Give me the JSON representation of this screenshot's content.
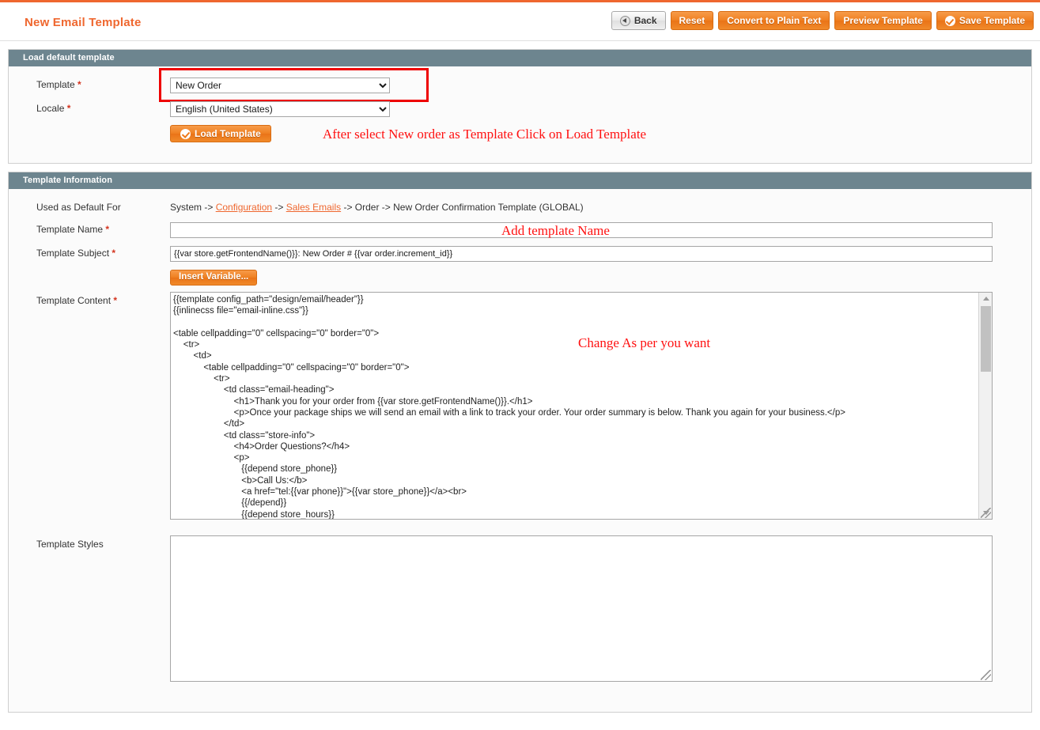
{
  "header": {
    "title": "New Email Template",
    "buttons": [
      {
        "name": "back",
        "label": "Back",
        "style": "gray",
        "icon": "back-arrow-icon"
      },
      {
        "name": "reset",
        "label": "Reset",
        "style": "orange",
        "icon": ""
      },
      {
        "name": "convert-to-plain-text",
        "label": "Convert to Plain Text",
        "style": "orange",
        "icon": ""
      },
      {
        "name": "preview-template",
        "label": "Preview Template",
        "style": "orange",
        "icon": ""
      },
      {
        "name": "save-template",
        "label": "Save Template",
        "style": "orange",
        "icon": "check-circle-icon"
      }
    ]
  },
  "load_default_template": {
    "legend": "Load default template",
    "template_label": "Template",
    "template_value": "New Order",
    "locale_label": "Locale",
    "locale_value": "English (United States)",
    "load_button_label": "Load Template",
    "annotation": "After select New order as Template Click on Load Template"
  },
  "template_information": {
    "legend": "Template Information",
    "used_as_default_label": "Used as Default For",
    "used_as_default": {
      "prefix": "System -> ",
      "link1": "Configuration",
      "mid1": " -> ",
      "link2": "Sales Emails",
      "suffix": " -> Order -> New Order Confirmation Template  (GLOBAL)"
    },
    "template_name_label": "Template Name",
    "template_name_value": "",
    "template_name_annotation": "Add template Name",
    "template_subject_label": "Template Subject",
    "template_subject_value": "{{var store.getFrontendName()}}: New Order # {{var order.increment_id}}",
    "insert_variable_label": "Insert Variable...",
    "template_content_label": "Template Content",
    "template_content_annotation": "Change As per you want",
    "template_content_value": "{{template config_path=\"design/email/header\"}}\n{{inlinecss file=\"email-inline.css\"}}\n\n<table cellpadding=\"0\" cellspacing=\"0\" border=\"0\">\n    <tr>\n        <td>\n            <table cellpadding=\"0\" cellspacing=\"0\" border=\"0\">\n                <tr>\n                    <td class=\"email-heading\">\n                        <h1>Thank you for your order from {{var store.getFrontendName()}}.</h1>\n                        <p>Once your package ships we will send an email with a link to track your order. Your order summary is below. Thank you again for your business.</p>\n                    </td>\n                    <td class=\"store-info\">\n                        <h4>Order Questions?</h4>\n                        <p>\n                           {{depend store_phone}}\n                           <b>Call Us:</b>\n                           <a href=\"tel:{{var phone}}\">{{var store_phone}}</a><br>\n                           {{/depend}}\n                           {{depend store_hours}}\n                           <span class=\"no-link\">{{var store_hours}}</span><br>",
    "template_styles_label": "Template Styles",
    "template_styles_value": ""
  },
  "colors": {
    "accent_orange": "#ef672f",
    "legend_bar": "#6d858f",
    "annotation_red": "#ff1111",
    "highlight_box": "#ee0000"
  }
}
